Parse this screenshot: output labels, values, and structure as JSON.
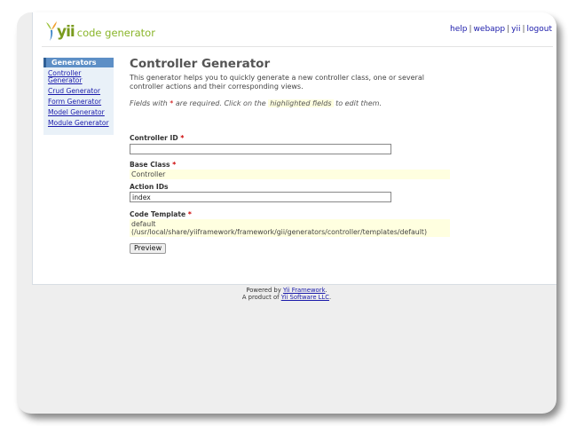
{
  "header": {
    "logo_word": "yii",
    "logo_sub": "code generator",
    "nav": [
      "help",
      "webapp",
      "yii",
      "logout"
    ]
  },
  "sidebar": {
    "title": "Generators",
    "items": [
      "Controller Generator",
      "Crud Generator",
      "Form Generator",
      "Model Generator",
      "Module Generator"
    ]
  },
  "main": {
    "title": "Controller Generator",
    "intro": "This generator helps you to quickly generate a new controller class, one or several controller actions and their corresponding views.",
    "note_prefix": "Fields with",
    "note_mid": "are required. Click on the",
    "note_highlight": "highlighted fields",
    "note_suffix": "to edit them.",
    "required_mark": "*",
    "fields": {
      "controller_id": {
        "label": "Controller ID",
        "value": ""
      },
      "base_class": {
        "label": "Base Class",
        "value": "Controller"
      },
      "action_ids": {
        "label": "Action IDs",
        "value": "index"
      },
      "code_template": {
        "label": "Code Template",
        "line1": "default",
        "line2": "(/usr/local/share/yiiframework/framework/gii/generators/controller/templates/default)"
      }
    },
    "preview_label": "Preview"
  },
  "footer": {
    "line1_prefix": "Powered by",
    "line1_link": "Yii Framework",
    "line2_prefix": "A product of",
    "line2_link": "Yii Software LLC"
  },
  "colors": {
    "accent": "#5d8fc6",
    "highlight": "#ffffe0",
    "link": "#1a1aaa",
    "brand": "#7a9b1e"
  }
}
